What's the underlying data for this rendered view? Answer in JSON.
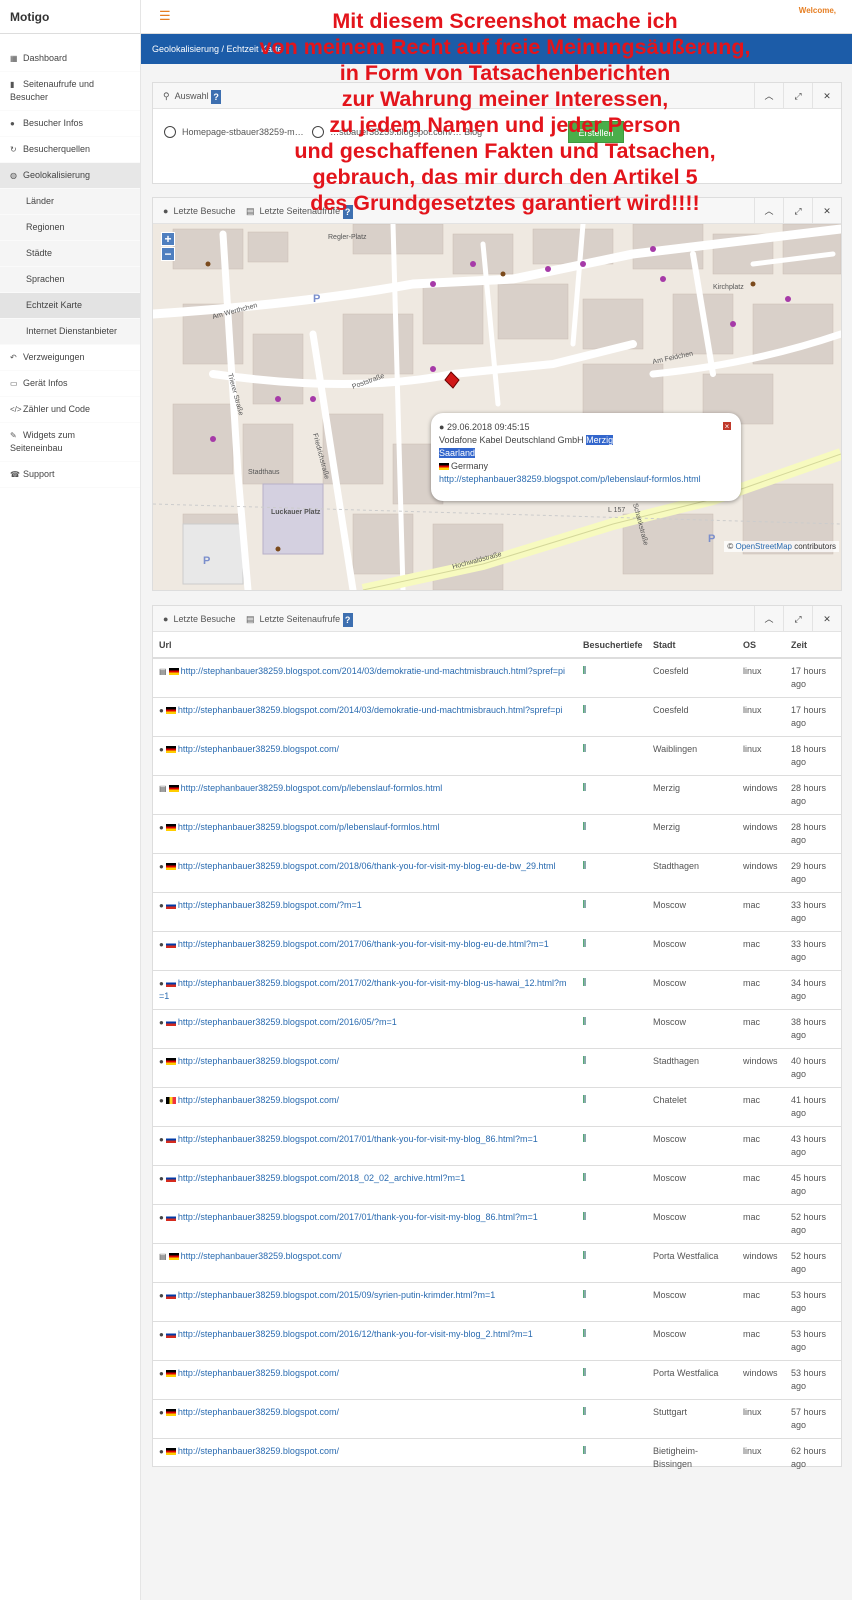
{
  "app": {
    "logo": "Motigo",
    "welcome": "Welcome,"
  },
  "breadcrumb": {
    "path": "Geolokalisierung / Echtzeit Karte"
  },
  "sidebar": {
    "items": [
      {
        "label": "Dashboard",
        "icon": "table-icon"
      },
      {
        "label": "Seitenaufrufe und Besucher",
        "icon": "bar-chart-icon"
      },
      {
        "label": "Besucher Infos",
        "icon": "user-icon"
      },
      {
        "label": "Besucherquellen",
        "icon": "refresh-icon"
      },
      {
        "label": "Geolokalisierung",
        "icon": "globe-icon"
      },
      {
        "label": "Länder"
      },
      {
        "label": "Regionen"
      },
      {
        "label": "Städte"
      },
      {
        "label": "Sprachen"
      },
      {
        "label": "Echtzeit Karte"
      },
      {
        "label": "Internet Dienstanbieter"
      },
      {
        "label": "Verzweigungen",
        "icon": "reply-icon"
      },
      {
        "label": "Gerät Infos",
        "icon": "desktop-icon"
      },
      {
        "label": "Zähler und Code",
        "icon": "code-icon"
      },
      {
        "label": "Widgets zum Seiteneinbau",
        "icon": "wrench-icon"
      },
      {
        "label": "Support",
        "icon": "phone-icon"
      }
    ]
  },
  "overlay": {
    "lines": [
      "Mit diesem Screenshot mache ich",
      "von meinem Recht auf freie Meinungsäußerung,",
      "in Form von Tatsachenberichten",
      "zur Wahrung meiner Interessen,",
      "zu jedem Namen und jeder Person",
      "und geschaffenen Fakten und Tatsachen,",
      "gebrauch, das mir durch den Artikel 5",
      "des Grundgesetztes garantiert wird!!!!"
    ]
  },
  "panel_selection": {
    "title": "Auswahl",
    "help": "?",
    "radio1": "Homepage-stbauer38259-m…",
    "radio2": "…stbauer38259.blogspot.com/… Blog",
    "create_button": "Erstellen"
  },
  "panel_map": {
    "title1": "Letzte Besuche",
    "title2": "Letzte Seitenaufrufe",
    "help": "?",
    "zoom_in": "+",
    "zoom_out": "−",
    "popup": {
      "datetime": "29.06.2018 09:45:15",
      "isp": "Vodafone Kabel Deutschland GmbH",
      "city": "Merzig",
      "region": "Saarland",
      "country": "Germany",
      "url": "http://stephanbauer38259.blogspot.com/p/lebenslauf-formlos.html"
    },
    "attribution_prefix": "©",
    "attribution_link": "OpenStreetMap",
    "attribution_suffix": "contributors",
    "street_labels": [
      "Am Werthchen",
      "Poststraße",
      "Trierer Straße",
      "Friedrichstraße",
      "Hochwaldstraße",
      "Schankstraße",
      "Am Feldchen",
      "Kirchplatz",
      "Luckauer Platz",
      "Regler-Platz",
      "Stadthaus",
      "L 157"
    ]
  },
  "panel_table": {
    "title1": "Letzte Besuche",
    "title2": "Letzte Seitenaufrufe",
    "help": "?",
    "columns": [
      "Url",
      "Besuchertiefe",
      "Stadt",
      "OS",
      "Zeit"
    ],
    "rows": [
      {
        "icon": "file",
        "flag": "de",
        "url": "http://stephanbauer38259.blogspot.com/2014/03/demokratie-und-machtmisbrauch.html?spref=pi",
        "city": "Coesfeld",
        "os": "linux",
        "time": "17 hours ago"
      },
      {
        "icon": "user",
        "flag": "de",
        "url": "http://stephanbauer38259.blogspot.com/2014/03/demokratie-und-machtmisbrauch.html?spref=pi",
        "city": "Coesfeld",
        "os": "linux",
        "time": "17 hours ago"
      },
      {
        "icon": "user",
        "flag": "de",
        "url": "http://stephanbauer38259.blogspot.com/",
        "city": "Waiblingen",
        "os": "linux",
        "time": "18 hours ago"
      },
      {
        "icon": "file",
        "flag": "de",
        "url": "http://stephanbauer38259.blogspot.com/p/lebenslauf-formlos.html",
        "city": "Merzig",
        "os": "windows",
        "time": "28 hours ago"
      },
      {
        "icon": "user",
        "flag": "de",
        "url": "http://stephanbauer38259.blogspot.com/p/lebenslauf-formlos.html",
        "city": "Merzig",
        "os": "windows",
        "time": "28 hours ago"
      },
      {
        "icon": "user",
        "flag": "de",
        "url": "http://stephanbauer38259.blogspot.com/2018/06/thank-you-for-visit-my-blog-eu-de-bw_29.html",
        "city": "Stadthagen",
        "os": "windows",
        "time": "29 hours ago"
      },
      {
        "icon": "user",
        "flag": "ru",
        "url": "http://stephanbauer38259.blogspot.com/?m=1",
        "city": "Moscow",
        "os": "mac",
        "time": "33 hours ago"
      },
      {
        "icon": "user",
        "flag": "ru",
        "url": "http://stephanbauer38259.blogspot.com/2017/06/thank-you-for-visit-my-blog-eu-de.html?m=1",
        "city": "Moscow",
        "os": "mac",
        "time": "33 hours ago"
      },
      {
        "icon": "user",
        "flag": "ru",
        "url": "http://stephanbauer38259.blogspot.com/2017/02/thank-you-for-visit-my-blog-us-hawai_12.html?m=1",
        "city": "Moscow",
        "os": "mac",
        "time": "34 hours ago"
      },
      {
        "icon": "user",
        "flag": "ru",
        "url": "http://stephanbauer38259.blogspot.com/2016/05/?m=1",
        "city": "Moscow",
        "os": "mac",
        "time": "38 hours ago"
      },
      {
        "icon": "user",
        "flag": "de",
        "url": "http://stephanbauer38259.blogspot.com/",
        "city": "Stadthagen",
        "os": "windows",
        "time": "40 hours ago"
      },
      {
        "icon": "user",
        "flag": "be",
        "url": "http://stephanbauer38259.blogspot.com/",
        "city": "Chatelet",
        "os": "mac",
        "time": "41 hours ago"
      },
      {
        "icon": "user",
        "flag": "ru",
        "url": "http://stephanbauer38259.blogspot.com/2017/01/thank-you-for-visit-my-blog_86.html?m=1",
        "city": "Moscow",
        "os": "mac",
        "time": "43 hours ago"
      },
      {
        "icon": "user",
        "flag": "ru",
        "url": "http://stephanbauer38259.blogspot.com/2018_02_02_archive.html?m=1",
        "city": "Moscow",
        "os": "mac",
        "time": "45 hours ago"
      },
      {
        "icon": "user",
        "flag": "ru",
        "url": "http://stephanbauer38259.blogspot.com/2017/01/thank-you-for-visit-my-blog_86.html?m=1",
        "city": "Moscow",
        "os": "mac",
        "time": "52 hours ago"
      },
      {
        "icon": "file",
        "flag": "de",
        "url": "http://stephanbauer38259.blogspot.com/",
        "city": "Porta Westfalica",
        "os": "windows",
        "time": "52 hours ago"
      },
      {
        "icon": "user",
        "flag": "ru",
        "url": "http://stephanbauer38259.blogspot.com/2015/09/syrien-putin-krimder.html?m=1",
        "city": "Moscow",
        "os": "mac",
        "time": "53 hours ago"
      },
      {
        "icon": "user",
        "flag": "ru",
        "url": "http://stephanbauer38259.blogspot.com/2016/12/thank-you-for-visit-my-blog_2.html?m=1",
        "city": "Moscow",
        "os": "mac",
        "time": "53 hours ago"
      },
      {
        "icon": "user",
        "flag": "de",
        "url": "http://stephanbauer38259.blogspot.com/",
        "city": "Porta Westfalica",
        "os": "windows",
        "time": "53 hours ago"
      },
      {
        "icon": "user",
        "flag": "de",
        "url": "http://stephanbauer38259.blogspot.com/",
        "city": "Stuttgart",
        "os": "linux",
        "time": "57 hours ago"
      },
      {
        "icon": "user",
        "flag": "de",
        "url": "http://stephanbauer38259.blogspot.com/",
        "city": "Bietigheim-Bissingen",
        "os": "linux",
        "time": "62 hours ago"
      }
    ]
  },
  "colors": {
    "accent": "#e67e22",
    "brand_bar": "#1c5ca8",
    "overlay_text": "#e3141b",
    "link": "#2a6bb0",
    "create_button": "#4aae4a"
  }
}
